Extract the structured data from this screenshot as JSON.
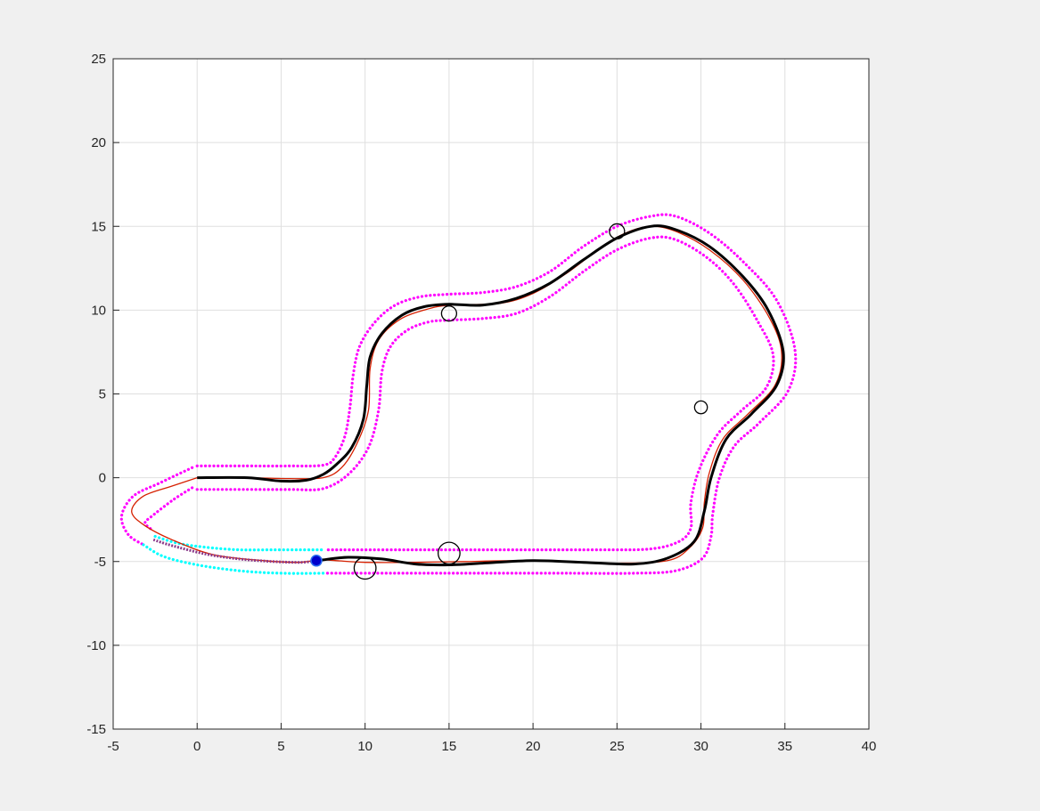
{
  "chart_data": {
    "type": "line",
    "title": "",
    "xlabel": "",
    "ylabel": "",
    "xlim": [
      -5,
      40
    ],
    "ylim": [
      -15,
      25
    ],
    "xticks": [
      -5,
      0,
      5,
      10,
      15,
      20,
      25,
      30,
      35,
      40
    ],
    "yticks": [
      -15,
      -10,
      -5,
      0,
      5,
      10,
      15,
      20,
      25
    ],
    "grid": true,
    "colors": {
      "background": "#f0f0f0",
      "axes_bg": "#ffffff",
      "grid": "#dfdfdf",
      "axis": "#262626",
      "boundary": "#ff00ff",
      "horizon_boundary": "#00ffff",
      "centerline": "#000000",
      "trajectory": "#d62000",
      "obstacle": "#000000",
      "vehicle": "#0000cc"
    },
    "series": [
      {
        "style": "black-thick-line",
        "points": [
          [
            0,
            0
          ],
          [
            3,
            0
          ],
          [
            5,
            -0.2
          ],
          [
            6.5,
            -0.15
          ],
          [
            7.5,
            0.2
          ],
          [
            8.3,
            0.8
          ],
          [
            9.2,
            1.8
          ],
          [
            9.9,
            3.5
          ],
          [
            10.1,
            5.5
          ],
          [
            10.3,
            7.2
          ],
          [
            11,
            8.6
          ],
          [
            12.2,
            9.7
          ],
          [
            13.5,
            10.2
          ],
          [
            15,
            10.35
          ],
          [
            17,
            10.3
          ],
          [
            19,
            10.7
          ],
          [
            21,
            11.6
          ],
          [
            23,
            13
          ],
          [
            25,
            14.3
          ],
          [
            27,
            15
          ],
          [
            28.5,
            14.8
          ],
          [
            30.5,
            13.8
          ],
          [
            32.5,
            12
          ],
          [
            34,
            10
          ],
          [
            34.9,
            7.5
          ],
          [
            34.5,
            5.5
          ],
          [
            33,
            3.8
          ],
          [
            31.5,
            2.3
          ],
          [
            30.6,
            0
          ],
          [
            30.2,
            -2
          ],
          [
            29.6,
            -3.8
          ],
          [
            28,
            -4.8
          ],
          [
            26,
            -5.15
          ],
          [
            23,
            -5.05
          ],
          [
            20,
            -4.95
          ],
          [
            17,
            -5.1
          ],
          [
            15,
            -5.2
          ],
          [
            13,
            -5.15
          ],
          [
            11,
            -4.85
          ],
          [
            9,
            -4.75
          ],
          [
            7.5,
            -4.9
          ],
          [
            7.2,
            -4.95
          ]
        ]
      },
      {
        "style": "red-thin-line",
        "points": [
          [
            0,
            0
          ],
          [
            3,
            0
          ],
          [
            5.5,
            -0.05
          ],
          [
            7.5,
            0
          ],
          [
            8.6,
            0.6
          ],
          [
            9.5,
            2
          ],
          [
            10.2,
            4
          ],
          [
            10.3,
            6.5
          ],
          [
            10.8,
            8.2
          ],
          [
            12,
            9.4
          ],
          [
            13.5,
            10
          ],
          [
            15,
            10.3
          ],
          [
            18,
            10.4
          ],
          [
            20,
            11
          ],
          [
            22,
            12.2
          ],
          [
            24,
            13.7
          ],
          [
            25.5,
            14.6
          ],
          [
            27,
            15
          ],
          [
            28.5,
            14.7
          ],
          [
            30.5,
            13.6
          ],
          [
            32.5,
            11.8
          ],
          [
            34.1,
            9.5
          ],
          [
            34.8,
            7.5
          ],
          [
            34.4,
            5.5
          ],
          [
            32.8,
            3.8
          ],
          [
            31.3,
            2.3
          ],
          [
            30.5,
            0.3
          ],
          [
            30.2,
            -1.5
          ],
          [
            30.1,
            -3
          ],
          [
            29.3,
            -4.2
          ],
          [
            28,
            -4.95
          ],
          [
            25,
            -5.1
          ],
          [
            22,
            -5
          ],
          [
            19,
            -4.95
          ],
          [
            16,
            -5
          ],
          [
            13,
            -5.05
          ],
          [
            10,
            -5.05
          ],
          [
            8.3,
            -4.95
          ],
          [
            7.3,
            -4.9
          ],
          [
            6,
            -5.05
          ],
          [
            4,
            -4.95
          ],
          [
            1,
            -4.6
          ],
          [
            -1.5,
            -3.7
          ],
          [
            -3.2,
            -2.8
          ],
          [
            -3.9,
            -2
          ],
          [
            -3.2,
            -1.1
          ],
          [
            -1.5,
            -0.5
          ],
          [
            0,
            0
          ]
        ]
      },
      {
        "style": "magenta-dotted-outer",
        "points": [
          [
            0,
            0.7
          ],
          [
            3,
            0.7
          ],
          [
            5.5,
            0.7
          ],
          [
            7.5,
            0.75
          ],
          [
            8.2,
            1.2
          ],
          [
            8.8,
            2.5
          ],
          [
            9.1,
            4.2
          ],
          [
            9.3,
            6.2
          ],
          [
            9.7,
            7.9
          ],
          [
            10.6,
            9.3
          ],
          [
            11.8,
            10.3
          ],
          [
            13.3,
            10.8
          ],
          [
            15,
            10.95
          ],
          [
            17,
            11.05
          ],
          [
            19,
            11.4
          ],
          [
            21,
            12.3
          ],
          [
            23,
            13.8
          ],
          [
            25,
            15
          ],
          [
            27,
            15.6
          ],
          [
            28.5,
            15.6
          ],
          [
            30.5,
            14.6
          ],
          [
            32.5,
            12.9
          ],
          [
            34.5,
            10.6
          ],
          [
            35.6,
            7.6
          ],
          [
            35.2,
            5.2
          ],
          [
            33.5,
            3.3
          ],
          [
            32,
            1.9
          ],
          [
            31.1,
            0
          ],
          [
            30.7,
            -2.2
          ],
          [
            30.6,
            -3.5
          ],
          [
            30.1,
            -4.8
          ],
          [
            28.5,
            -5.55
          ],
          [
            26,
            -5.7
          ],
          [
            22,
            -5.7
          ],
          [
            18,
            -5.7
          ],
          [
            14,
            -5.7
          ],
          [
            10,
            -5.7
          ],
          [
            7.7,
            -5.7
          ]
        ]
      },
      {
        "style": "magenta-dotted-inner",
        "points": [
          [
            0,
            -0.7
          ],
          [
            3,
            -0.7
          ],
          [
            5.5,
            -0.7
          ],
          [
            7.5,
            -0.65
          ],
          [
            9,
            0.2
          ],
          [
            10.2,
            1.8
          ],
          [
            10.8,
            4
          ],
          [
            11,
            6.3
          ],
          [
            11.5,
            7.8
          ],
          [
            12.5,
            8.8
          ],
          [
            13.8,
            9.3
          ],
          [
            15,
            9.4
          ],
          [
            17,
            9.5
          ],
          [
            19,
            9.8
          ],
          [
            21,
            10.8
          ],
          [
            23,
            12.3
          ],
          [
            25,
            13.6
          ],
          [
            27,
            14.3
          ],
          [
            28.5,
            14.2
          ],
          [
            30.4,
            13.1
          ],
          [
            32,
            11.5
          ],
          [
            33.4,
            9.3
          ],
          [
            34.3,
            7.3
          ],
          [
            33.9,
            5.4
          ],
          [
            32.4,
            4
          ],
          [
            31,
            2.6
          ],
          [
            29.9,
            0.5
          ],
          [
            29.4,
            -1.5
          ],
          [
            29.4,
            -3
          ],
          [
            28.7,
            -3.8
          ],
          [
            27,
            -4.25
          ],
          [
            24,
            -4.3
          ],
          [
            20,
            -4.3
          ],
          [
            16,
            -4.3
          ],
          [
            12,
            -4.3
          ],
          [
            7.7,
            -4.3
          ]
        ]
      },
      {
        "style": "magenta-dotted-left-outer",
        "points": [
          [
            -0.3,
            0.6
          ],
          [
            -2.2,
            -0.3
          ],
          [
            -3.8,
            -1.1
          ],
          [
            -4.5,
            -2.3
          ],
          [
            -4.1,
            -3.4
          ],
          [
            -3.2,
            -4
          ]
        ]
      },
      {
        "style": "magenta-dotted-left-inner",
        "points": [
          [
            -0.3,
            -0.6
          ],
          [
            -1.4,
            -1.3
          ],
          [
            -2.7,
            -2.3
          ],
          [
            -3.1,
            -2.7
          ],
          [
            -2.7,
            -3.1
          ]
        ]
      },
      {
        "style": "cyan-dotted-upper",
        "points": [
          [
            -2.5,
            -3.5
          ],
          [
            -1.2,
            -3.9
          ],
          [
            0.5,
            -4.15
          ],
          [
            2.5,
            -4.3
          ],
          [
            4.5,
            -4.3
          ],
          [
            6.5,
            -4.3
          ],
          [
            7.6,
            -4.3
          ]
        ]
      },
      {
        "style": "cyan-dotted-lower",
        "points": [
          [
            -3.2,
            -4
          ],
          [
            -2,
            -4.7
          ],
          [
            0,
            -5.2
          ],
          [
            2.5,
            -5.55
          ],
          [
            5,
            -5.7
          ],
          [
            7.6,
            -5.7
          ]
        ]
      },
      {
        "style": "horizon-prediction",
        "points": [
          [
            -2.6,
            -3.7
          ],
          [
            -1.5,
            -4.05
          ],
          [
            0.5,
            -4.55
          ],
          [
            2.5,
            -4.85
          ],
          [
            4.5,
            -5
          ],
          [
            6.2,
            -5.05
          ],
          [
            7.1,
            -4.95
          ]
        ]
      }
    ],
    "obstacles": [
      {
        "x": 25,
        "y": 14.7,
        "r": 0.45
      },
      {
        "x": 15,
        "y": 9.8,
        "r": 0.45
      },
      {
        "x": 30,
        "y": 4.2,
        "r": 0.38
      },
      {
        "x": 15,
        "y": -4.5,
        "r": 0.65
      },
      {
        "x": 10,
        "y": -5.4,
        "r": 0.65
      }
    ],
    "vehicle": {
      "x": 7.1,
      "y": -4.95
    }
  }
}
